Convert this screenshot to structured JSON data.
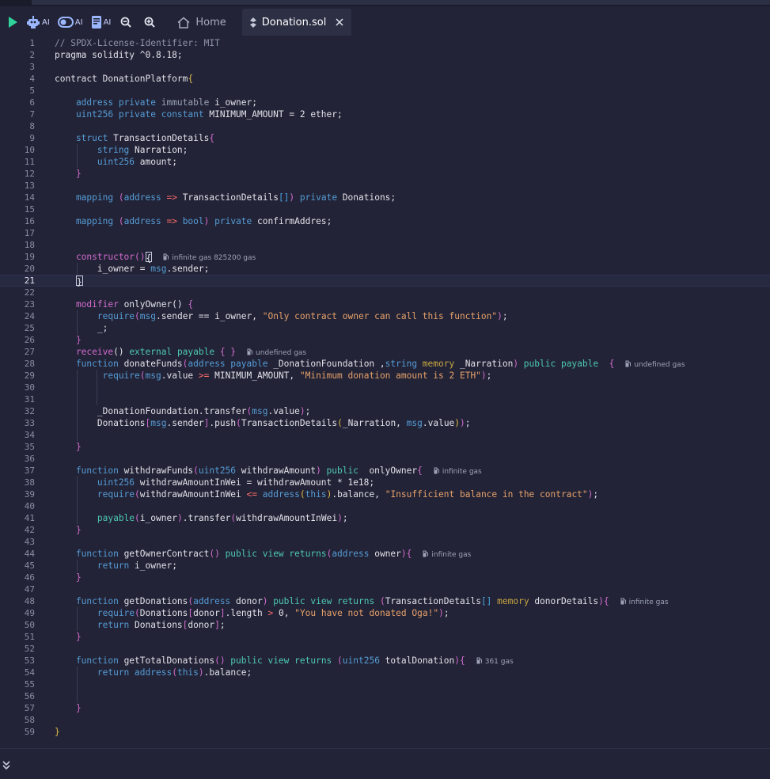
{
  "toolbar": {
    "ai_label_1": "AI",
    "ai_label_2": "AI",
    "ai_label_3": "AI",
    "icons": [
      "run-icon",
      "robot-icon",
      "toggle-icon",
      "book-icon",
      "zoom-out-icon",
      "zoom-in-icon"
    ]
  },
  "tabs": [
    {
      "label": "Home"
    },
    {
      "label": "Donation.sol",
      "active": true
    }
  ],
  "editor": {
    "current_line": 21,
    "lines": [
      [
        [
          "// SPDX-License-Identifier: MIT",
          "t-comment"
        ]
      ],
      [
        [
          "pragma solidity ^0.8.18;",
          "t-ident"
        ]
      ],
      [],
      [
        [
          "contract DonationPlatform",
          "t-ident"
        ],
        [
          "{",
          "t-brace"
        ]
      ],
      [],
      [
        [
          "    address ",
          "t-kw"
        ],
        [
          "private ",
          "t-kw"
        ],
        [
          "immutable ",
          "t-gray"
        ],
        [
          "i_owner;",
          "t-ident"
        ]
      ],
      [
        [
          "    uint256 ",
          "t-kw"
        ],
        [
          "private ",
          "t-kw"
        ],
        [
          "constant ",
          "t-kw"
        ],
        [
          "MINIMUM_AMOUNT = 2 ether;",
          "t-ident"
        ]
      ],
      [],
      [
        [
          "    struct ",
          "t-kw"
        ],
        [
          "TransactionDetails",
          "t-ident"
        ],
        [
          "{",
          "t-brace2"
        ]
      ],
      [
        [
          "        string ",
          "t-kw"
        ],
        [
          "Narration;",
          "t-ident"
        ]
      ],
      [
        [
          "        uint256 ",
          "t-kw"
        ],
        [
          "amount;",
          "t-ident"
        ]
      ],
      [
        [
          "    ",
          "t-ident"
        ],
        [
          "}",
          "t-brace2"
        ]
      ],
      [],
      [
        [
          "    mapping ",
          "t-kw"
        ],
        [
          "(",
          "t-brace2"
        ],
        [
          "address ",
          "t-kw"
        ],
        [
          "=>",
          "t-op"
        ],
        [
          " TransactionDetails",
          "t-ident"
        ],
        [
          "[]",
          "t-brace3"
        ],
        [
          ")",
          "t-brace2"
        ],
        [
          " private ",
          "t-kw"
        ],
        [
          "Donations;",
          "t-ident"
        ]
      ],
      [],
      [
        [
          "    mapping ",
          "t-kw"
        ],
        [
          "(",
          "t-brace2"
        ],
        [
          "address ",
          "t-kw"
        ],
        [
          "=>",
          "t-op"
        ],
        [
          " bool",
          "t-kw"
        ],
        [
          ")",
          "t-brace2"
        ],
        [
          " private ",
          "t-kw"
        ],
        [
          "confirmAddres;",
          "t-ident"
        ]
      ],
      [],
      [],
      [
        [
          "    constructor",
          "t-brace2"
        ],
        [
          "()",
          "t-brace2"
        ],
        [
          "{",
          "t-cursorbox"
        ]
      ],
      [
        [
          "        i_owner = ",
          "t-ident"
        ],
        [
          "msg",
          "t-kw"
        ],
        [
          ".sender;",
          "t-ident"
        ]
      ],
      [
        [
          "    ",
          "t-ident"
        ],
        [
          "}",
          "t-cursorbox"
        ]
      ],
      [],
      [
        [
          "    modifier ",
          "t-brace2"
        ],
        [
          "onlyOwner() ",
          "t-ident"
        ],
        [
          "{",
          "t-brace2"
        ]
      ],
      [
        [
          "        require",
          "t-kw"
        ],
        [
          "(",
          "t-brace2"
        ],
        [
          "msg",
          "t-kw"
        ],
        [
          ".sender == i_owner, ",
          "t-ident"
        ],
        [
          "\"Only contract owner can call this function\"",
          "t-str"
        ],
        [
          ")",
          "t-brace2"
        ],
        [
          ";",
          "t-ident"
        ]
      ],
      [
        [
          "        _;",
          "t-ident"
        ]
      ],
      [
        [
          "    ",
          "t-ident"
        ],
        [
          "}",
          "t-brace2"
        ]
      ],
      [
        [
          "    receive",
          "t-brace2"
        ],
        [
          "() ",
          "t-ident"
        ],
        [
          "external ",
          "t-green"
        ],
        [
          "payable ",
          "t-green"
        ],
        [
          "{ }",
          "t-brace2"
        ]
      ],
      [
        [
          "    function ",
          "t-kw"
        ],
        [
          "donateFunds",
          "t-ident"
        ],
        [
          "(",
          "t-brace2"
        ],
        [
          "address ",
          "t-kw"
        ],
        [
          "payable ",
          "t-kw"
        ],
        [
          "_DonationFoundation ,",
          "t-ident"
        ],
        [
          "string ",
          "t-kw"
        ],
        [
          "memory ",
          "t-mem"
        ],
        [
          "_Narration",
          "t-ident"
        ],
        [
          ")",
          "t-brace2"
        ],
        [
          " public ",
          "t-green"
        ],
        [
          "payable  ",
          "t-green"
        ],
        [
          "{",
          "t-brace2"
        ]
      ],
      [
        [
          "         require",
          "t-kw"
        ],
        [
          "(",
          "t-brace2"
        ],
        [
          "msg",
          "t-kw"
        ],
        [
          ".value ",
          "t-ident"
        ],
        [
          ">=",
          "t-op"
        ],
        [
          " MINIMUM_AMOUNT, ",
          "t-ident"
        ],
        [
          "\"Minimum donation amount is 2 ETH\"",
          "t-str"
        ],
        [
          ")",
          "t-brace2"
        ],
        [
          ";",
          "t-ident"
        ]
      ],
      [],
      [],
      [
        [
          "        _DonationFoundation.transfer",
          "t-ident"
        ],
        [
          "(",
          "t-brace2"
        ],
        [
          "msg",
          "t-kw"
        ],
        [
          ".value",
          "t-ident"
        ],
        [
          ")",
          "t-brace2"
        ],
        [
          ";",
          "t-ident"
        ]
      ],
      [
        [
          "        Donations",
          "t-ident"
        ],
        [
          "[",
          "t-brace2"
        ],
        [
          "msg",
          "t-kw"
        ],
        [
          ".sender",
          "t-ident"
        ],
        [
          "]",
          "t-brace2"
        ],
        [
          ".push",
          "t-ident"
        ],
        [
          "(",
          "t-brace2"
        ],
        [
          "TransactionDetails",
          "t-ident"
        ],
        [
          "(",
          "t-brace"
        ],
        [
          "_Narration, ",
          "t-ident"
        ],
        [
          "msg",
          "t-kw"
        ],
        [
          ".value",
          "t-ident"
        ],
        [
          ")",
          "t-brace"
        ],
        [
          ")",
          "t-brace2"
        ],
        [
          ";",
          "t-ident"
        ]
      ],
      [],
      [
        [
          "    ",
          "t-ident"
        ],
        [
          "}",
          "t-brace2"
        ]
      ],
      [],
      [
        [
          "    function ",
          "t-kw"
        ],
        [
          "withdrawFunds",
          "t-ident"
        ],
        [
          "(",
          "t-brace2"
        ],
        [
          "uint256 ",
          "t-kw"
        ],
        [
          "withdrawAmount",
          "t-ident"
        ],
        [
          ")",
          "t-brace2"
        ],
        [
          " public  ",
          "t-green"
        ],
        [
          "onlyOwner",
          "t-ident"
        ],
        [
          "{",
          "t-brace2"
        ]
      ],
      [
        [
          "        uint256 ",
          "t-kw"
        ],
        [
          "withdrawAmountInWei = withdrawAmount * 1e18;",
          "t-ident"
        ]
      ],
      [
        [
          "        require",
          "t-kw"
        ],
        [
          "(",
          "t-brace2"
        ],
        [
          "withdrawAmountInWei ",
          "t-ident"
        ],
        [
          "<=",
          "t-op"
        ],
        [
          " address",
          "t-kw"
        ],
        [
          "(",
          "t-brace"
        ],
        [
          "this",
          "t-kw"
        ],
        [
          ")",
          "t-brace"
        ],
        [
          ".balance, ",
          "t-ident"
        ],
        [
          "\"Insufficient balance in the contract\"",
          "t-str"
        ],
        [
          ")",
          "t-brace2"
        ],
        [
          ";",
          "t-ident"
        ]
      ],
      [],
      [
        [
          "        payable",
          "t-green"
        ],
        [
          "(",
          "t-brace2"
        ],
        [
          "i_owner",
          "t-ident"
        ],
        [
          ")",
          "t-brace2"
        ],
        [
          ".transfer",
          "t-ident"
        ],
        [
          "(",
          "t-brace2"
        ],
        [
          "withdrawAmountInWei",
          "t-ident"
        ],
        [
          ")",
          "t-brace2"
        ],
        [
          ";",
          "t-ident"
        ]
      ],
      [
        [
          "    ",
          "t-ident"
        ],
        [
          "}",
          "t-brace2"
        ]
      ],
      [],
      [
        [
          "    function ",
          "t-kw"
        ],
        [
          "getOwnerContract",
          "t-ident"
        ],
        [
          "() ",
          "t-brace2"
        ],
        [
          "public ",
          "t-green"
        ],
        [
          "view ",
          "t-green"
        ],
        [
          "returns",
          "t-green"
        ],
        [
          "(",
          "t-brace2"
        ],
        [
          "address ",
          "t-kw"
        ],
        [
          "owner",
          "t-ident"
        ],
        [
          ")",
          "t-brace2"
        ],
        [
          "{",
          "t-brace2"
        ]
      ],
      [
        [
          "        return ",
          "t-kw"
        ],
        [
          "i_owner;",
          "t-ident"
        ]
      ],
      [
        [
          "    ",
          "t-ident"
        ],
        [
          "}",
          "t-brace2"
        ]
      ],
      [],
      [
        [
          "    function ",
          "t-kw"
        ],
        [
          "getDonations",
          "t-ident"
        ],
        [
          "(",
          "t-brace2"
        ],
        [
          "address ",
          "t-kw"
        ],
        [
          "donor",
          "t-ident"
        ],
        [
          ")",
          "t-brace2"
        ],
        [
          " public ",
          "t-green"
        ],
        [
          "view ",
          "t-green"
        ],
        [
          "returns ",
          "t-green"
        ],
        [
          "(",
          "t-brace2"
        ],
        [
          "TransactionDetails",
          "t-ident"
        ],
        [
          "[]",
          "t-brace3"
        ],
        [
          " memory ",
          "t-mem"
        ],
        [
          "donorDetails",
          "t-ident"
        ],
        [
          ")",
          "t-brace2"
        ],
        [
          "{",
          "t-brace2"
        ]
      ],
      [
        [
          "        require",
          "t-kw"
        ],
        [
          "(",
          "t-brace2"
        ],
        [
          "Donations",
          "t-ident"
        ],
        [
          "[",
          "t-brace2"
        ],
        [
          "donor",
          "t-ident"
        ],
        [
          "]",
          "t-brace2"
        ],
        [
          ".length ",
          "t-ident"
        ],
        [
          ">",
          "t-op"
        ],
        [
          " 0, ",
          "t-ident"
        ],
        [
          "\"You have not donated Oga!\"",
          "t-str"
        ],
        [
          ")",
          "t-brace2"
        ],
        [
          ";",
          "t-ident"
        ]
      ],
      [
        [
          "        return ",
          "t-kw"
        ],
        [
          "Donations",
          "t-ident"
        ],
        [
          "[",
          "t-brace2"
        ],
        [
          "donor",
          "t-ident"
        ],
        [
          "]",
          "t-brace2"
        ],
        [
          ";",
          "t-ident"
        ]
      ],
      [
        [
          "    ",
          "t-ident"
        ],
        [
          "}",
          "t-brace2"
        ]
      ],
      [],
      [
        [
          "    function ",
          "t-kw"
        ],
        [
          "getTotalDonations",
          "t-ident"
        ],
        [
          "() ",
          "t-brace2"
        ],
        [
          "public ",
          "t-green"
        ],
        [
          "view ",
          "t-green"
        ],
        [
          "returns ",
          "t-green"
        ],
        [
          "(",
          "t-brace2"
        ],
        [
          "uint256 ",
          "t-kw"
        ],
        [
          "totalDonation",
          "t-ident"
        ],
        [
          ")",
          "t-brace2"
        ],
        [
          "{",
          "t-brace2"
        ]
      ],
      [
        [
          "        return ",
          "t-kw"
        ],
        [
          "address",
          "t-kw"
        ],
        [
          "(",
          "t-brace2"
        ],
        [
          "this",
          "t-kw"
        ],
        [
          ")",
          "t-brace2"
        ],
        [
          ".balance;",
          "t-ident"
        ]
      ],
      [],
      [],
      [
        [
          "    ",
          "t-ident"
        ],
        [
          "}",
          "t-brace2"
        ]
      ],
      [],
      [
        [
          "}",
          "t-brace"
        ]
      ]
    ],
    "gas_hints": {
      "19": "infinite gas 825200 gas",
      "27": "undefined gas",
      "28": "undefined gas",
      "37": "infinite gas",
      "44": "infinite gas",
      "48": "infinite gas",
      "53": "361 gas"
    }
  }
}
